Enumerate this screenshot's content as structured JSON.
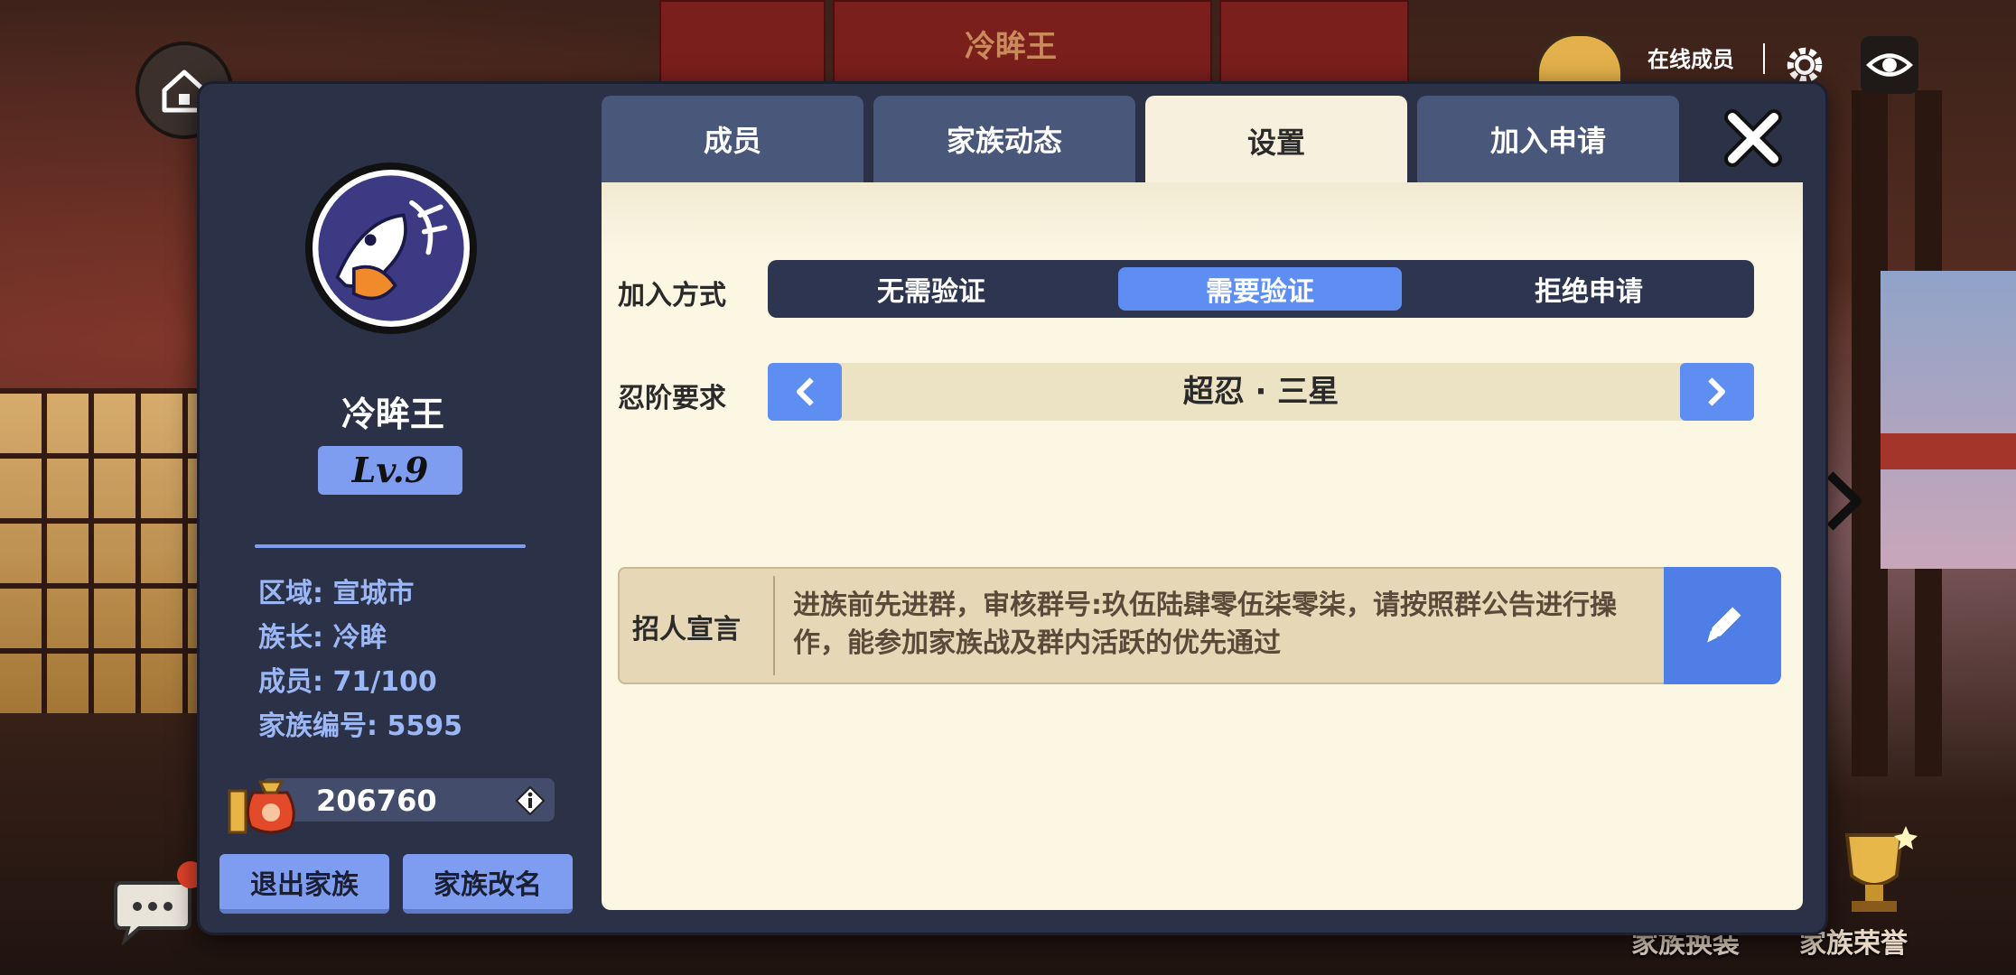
{
  "background": {
    "top_title": "冷眸王",
    "online_label": "在线成员",
    "bottom_left_label": "家族换装",
    "bottom_right_label": "家族荣誉",
    "icons": [
      "home-icon",
      "settings-gear-icon",
      "eye-icon",
      "chat-icon",
      "trophy-icon",
      "chevron-right-icon"
    ]
  },
  "family": {
    "name": "冷眸王",
    "level": "Lv.9",
    "region": "区域: 宣城市",
    "leader": "族长: 冷眸",
    "members": "成员: 71/100",
    "family_id": "家族编号: 5595",
    "funds": "206760",
    "quit_label": "退出家族",
    "rename_label": "家族改名"
  },
  "tabs": [
    {
      "label": "成员",
      "active": false
    },
    {
      "label": "家族动态",
      "active": false
    },
    {
      "label": "设置",
      "active": true
    },
    {
      "label": "加入申请",
      "active": false
    }
  ],
  "settings": {
    "join_method_label": "加入方式",
    "join_options": [
      {
        "label": "无需验证",
        "selected": false
      },
      {
        "label": "需要验证",
        "selected": true
      },
      {
        "label": "拒绝申请",
        "selected": false
      }
    ],
    "rank_label": "忍阶要求",
    "rank_value": "超忍 · 三星",
    "declaration_label": "招人宣言",
    "declaration_text": "进族前先进群，审核群号:玖伍陆肆零伍柒零柒，请按照群公告进行操作，能参加家族战及群内活跃的优先通过"
  },
  "colors": {
    "accent_blue": "#5f8ef2",
    "panel_dark": "#2b3147",
    "content_bg": "#fbf7e3",
    "info_text": "#9bb7f5"
  }
}
